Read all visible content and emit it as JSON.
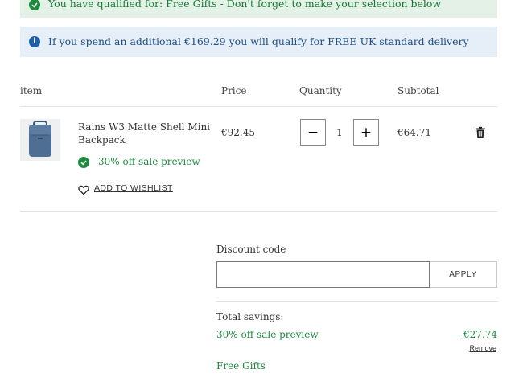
{
  "banners": {
    "gifts": "You have qualified for: Free Gifts - Don't forget to make your selection below",
    "delivery": "If you spend an additional €169.29 you will qualify for FREE UK standard delivery"
  },
  "table": {
    "headers": {
      "item": "item",
      "price": "Price",
      "quantity": "Quantity",
      "subtotal": "Subtotal"
    }
  },
  "item": {
    "name": "Rains W3 Matte Shell Mini Backpack",
    "promo": "30% off sale preview",
    "wishlist_label": "ADD TO WISHLIST",
    "price": "€92.45",
    "quantity": "1",
    "subtotal": "€64.71"
  },
  "discount": {
    "label": "Discount code",
    "value": "",
    "placeholder": "",
    "apply_label": "APPLY"
  },
  "savings": {
    "label": "Total savings:",
    "promo": "30% off sale preview",
    "amount": "- €27.74",
    "remove_label": "Remove",
    "free_gifts": "Free Gifts"
  },
  "colors": {
    "success": "#1e8a3d",
    "info": "#1d5fae",
    "success_bg": "#e4f1e6",
    "info_bg": "#e6eff8",
    "product": "#4f6e93"
  },
  "icons": {
    "gifts_banner": "check-circle-icon",
    "delivery_banner": "info-icon",
    "promo": "check-circle-icon",
    "wishlist": "heart-icon",
    "decrease": "minus-icon",
    "increase": "plus-icon",
    "remove_item": "trash-icon"
  }
}
